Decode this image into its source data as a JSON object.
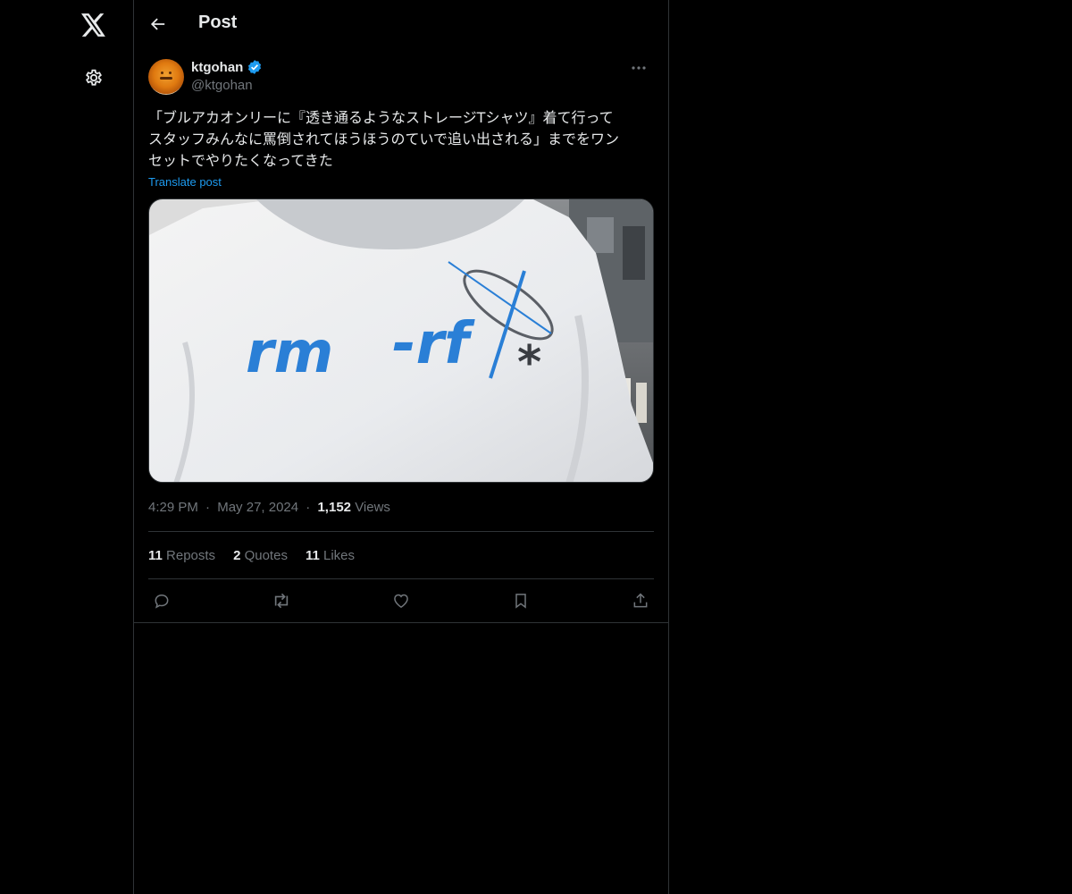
{
  "nav": {
    "logo_icon": "x-logo-icon",
    "settings_icon": "gear-icon"
  },
  "header": {
    "title": "Post"
  },
  "post": {
    "author": {
      "display_name": "ktgohan",
      "handle": "@ktgohan",
      "verified": true
    },
    "text": "「ブルアカオンリーに『透き通るようなストレージTシャツ』着て行って\nスタッフみんなに罵倒されてほうほうのていで追い出される」までをワン\nセットでやりたくなってきた",
    "translate_label": "Translate post",
    "time": "4:29 PM",
    "date": "May 27, 2024",
    "views_count": "1,152",
    "views_label": "Views",
    "separator": "·",
    "stats": {
      "reposts_count": "11",
      "reposts_label": "Reposts",
      "quotes_count": "2",
      "quotes_label": "Quotes",
      "likes_count": "11",
      "likes_label": "Likes"
    },
    "media": {
      "shirt_text_left": "rm",
      "shirt_text_right": "-rf",
      "shirt_star": "*"
    }
  },
  "colors": {
    "background": "#000000",
    "border": "#2f3336",
    "primary_text": "#e7e9ea",
    "secondary_text": "#71767b",
    "accent": "#1d9bf0",
    "shirt_print": "#2a7fd6"
  }
}
